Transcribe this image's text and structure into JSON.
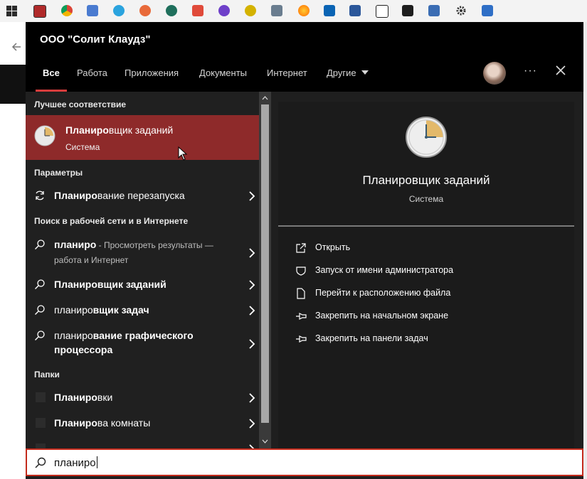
{
  "header": {
    "org_name": "ООО \"Солит Клаудз\"",
    "tabs": [
      {
        "label": "Все"
      },
      {
        "label": "Работа"
      },
      {
        "label": "Приложения"
      },
      {
        "label": "Документы"
      },
      {
        "label": "Интернет"
      },
      {
        "label": "Другие"
      }
    ],
    "more_label": "···"
  },
  "results": {
    "best_match_heading": "Лучшее соответствие",
    "best_match": {
      "title_bold": "Планиро",
      "title_rest": "вщик заданий",
      "subtitle": "Система"
    },
    "settings_heading": "Параметры",
    "settings_items": [
      {
        "bold": "Планиро",
        "rest": "вание перезапуска"
      }
    ],
    "web_heading": "Поиск в рабочей сети и в Интернете",
    "web_items": [
      {
        "bold": "планиро",
        "rest": "",
        "note": " - Просмотреть результаты —",
        "note2": "работа и Интернет"
      },
      {
        "bold": "Планиро",
        "rest": "вщик заданий"
      },
      {
        "bold": "планиро",
        "rest": "вщик задач"
      },
      {
        "bold": "планиро",
        "rest": "вание графического",
        "rest2": "процессора"
      }
    ],
    "folders_heading": "Папки",
    "folder_items": [
      {
        "bold": "Планиро",
        "rest": "вки"
      },
      {
        "bold": "Планиро",
        "rest": "ва комнаты"
      }
    ]
  },
  "preview": {
    "title": "Планировщик заданий",
    "category": "Система",
    "actions": [
      {
        "label": "Открыть",
        "icon": "open-icon"
      },
      {
        "label": "Запуск от имени администратора",
        "icon": "shield-icon"
      },
      {
        "label": "Перейти к расположению файла",
        "icon": "file-location-icon"
      },
      {
        "label": "Закрепить на начальном экране",
        "icon": "pin-icon"
      },
      {
        "label": "Закрепить на панели задач",
        "icon": "pin-icon"
      }
    ]
  },
  "search": {
    "value": "планиро"
  },
  "colors": {
    "accent": "#d73c3c",
    "selection": "#8e2a2a",
    "search_border": "#c42b1c"
  }
}
